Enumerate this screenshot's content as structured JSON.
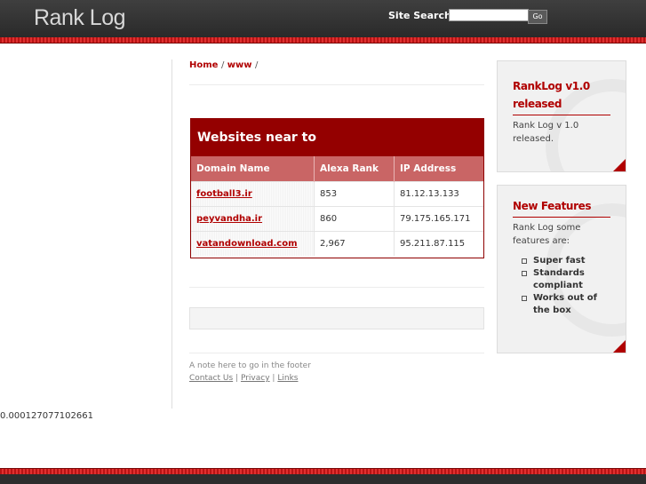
{
  "header": {
    "logo": "Rank Log",
    "search_label": "Site Search:",
    "search_value": "",
    "search_button": "Go"
  },
  "breadcrumb": {
    "home": "Home",
    "sep1": "/",
    "www": "www",
    "sep2": "/"
  },
  "table": {
    "title": "Websites near to",
    "columns": [
      "Domain Name",
      "Alexa Rank",
      "IP Address"
    ],
    "rows": [
      {
        "domain": "football3.ir",
        "rank": "853",
        "ip": "81.12.13.133"
      },
      {
        "domain": "peyvandha.ir",
        "rank": "860",
        "ip": "79.175.165.171"
      },
      {
        "domain": "vatandownload.com",
        "rank": "2,967",
        "ip": "95.211.87.115"
      }
    ]
  },
  "footer": {
    "note": "A note here to go in the footer",
    "links": [
      "Contact Us",
      "Privacy",
      "Links"
    ],
    "sep": "|"
  },
  "stat": "0.000127077102661",
  "sidebar": {
    "box1": {
      "title": "RankLog v1.0 released",
      "text": "Rank Log v 1.0 released."
    },
    "box2": {
      "title": "New Features",
      "text": "Rank Log some features are:",
      "items": [
        "Super fast",
        "Standards compliant",
        "Works out of the box"
      ]
    }
  },
  "colors": {
    "accent": "#b00000",
    "panel_header": "#940000",
    "table_header": "#c96565",
    "header_bg": "#333333"
  }
}
